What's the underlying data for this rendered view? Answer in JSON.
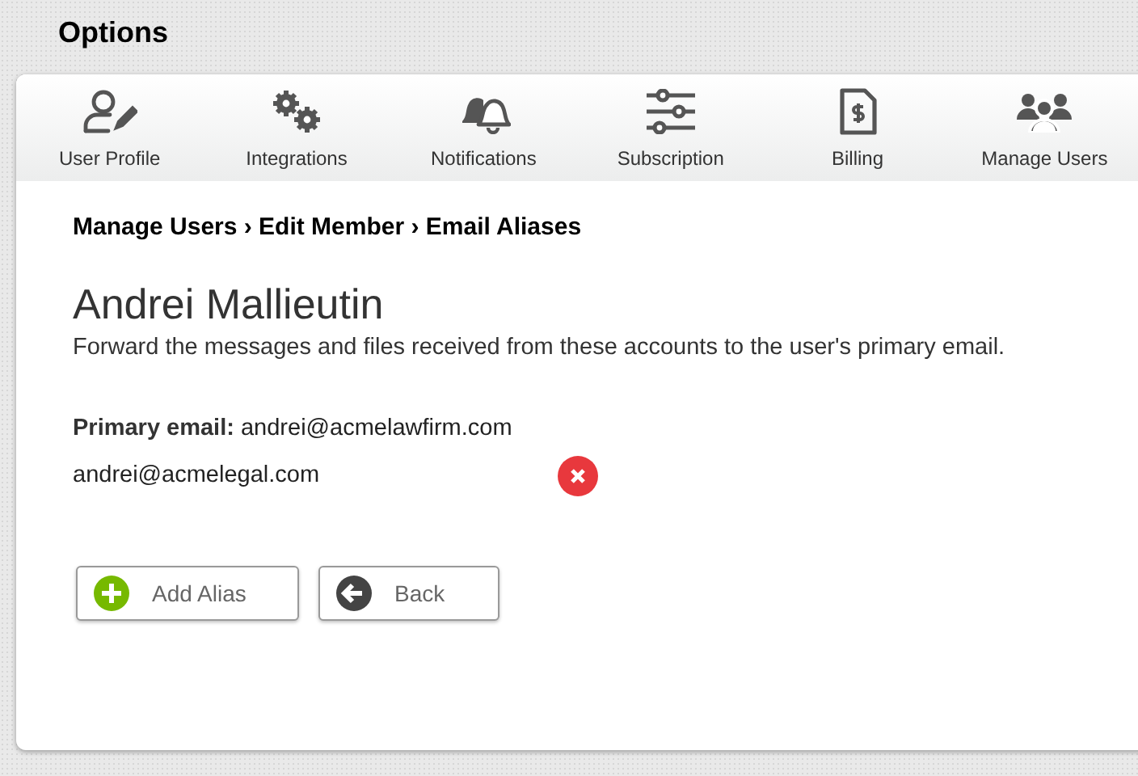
{
  "page_title": "Options",
  "tabs": [
    {
      "label": "User Profile",
      "kind": "user-edit"
    },
    {
      "label": "Integrations",
      "kind": "gears"
    },
    {
      "label": "Notifications",
      "kind": "bells"
    },
    {
      "label": "Subscription",
      "kind": "sliders"
    },
    {
      "label": "Billing",
      "kind": "invoice"
    },
    {
      "label": "Manage Users",
      "kind": "users"
    }
  ],
  "breadcrumb": "Manage Users › Edit Member › Email Aliases",
  "member_name": "Andrei Mallieutin",
  "description": "Forward the messages and files received from these accounts to the user's primary email.",
  "primary_email": {
    "label": "Primary email:",
    "value": "andrei@acmelawfirm.com"
  },
  "aliases": [
    "andrei@acmelegal.com"
  ],
  "buttons": [
    {
      "label": "Add Alias",
      "kind": "add"
    },
    {
      "label": "Back",
      "kind": "back"
    }
  ]
}
